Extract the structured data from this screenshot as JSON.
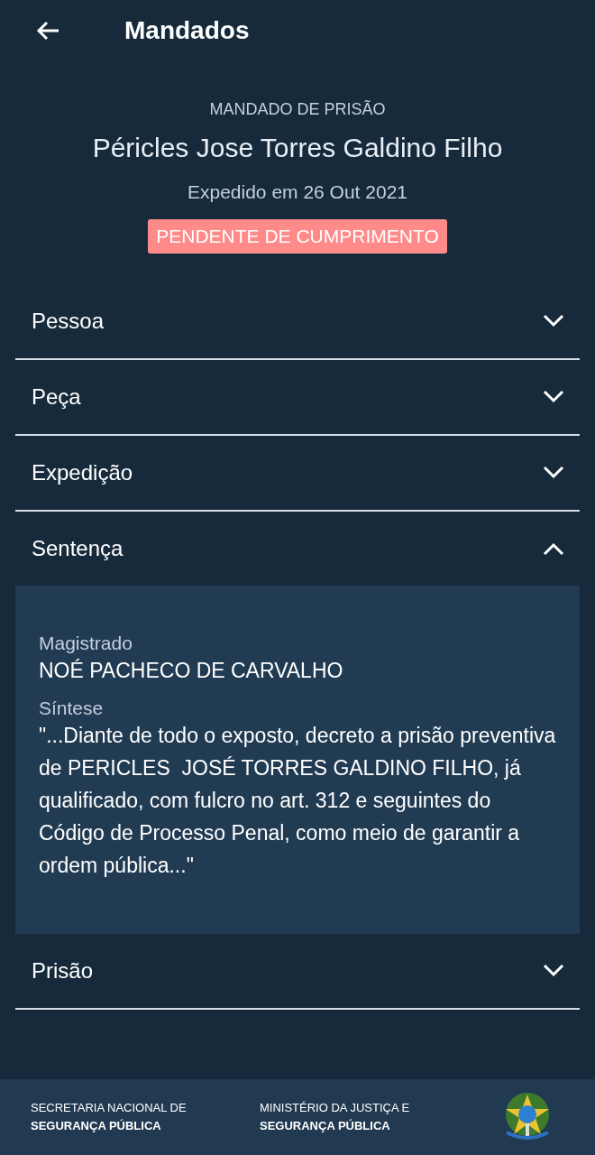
{
  "app_bar": {
    "title": "Mandados"
  },
  "header": {
    "type": "MANDADO DE PRISÃO",
    "name": "Péricles Jose Torres Galdino Filho",
    "issued": "Expedido em 26 Out 2021",
    "status": "PENDENTE DE CUMPRIMENTO"
  },
  "sections": [
    {
      "label": "Pessoa",
      "expanded": false
    },
    {
      "label": "Peça",
      "expanded": false
    },
    {
      "label": "Expedição",
      "expanded": false
    },
    {
      "label": "Sentença",
      "expanded": true,
      "fields": [
        {
          "label": "Magistrado",
          "value": "NOÉ PACHECO DE CARVALHO"
        },
        {
          "label": "Síntese",
          "value": "\"...Diante de todo o exposto, decreto a prisão preventiva de PERICLES  JOSÉ TORRES GALDINO FILHO, já qualificado, com fulcro no art. 312 e seguintes do Código de Processo Penal, como meio de garantir a ordem pública...\""
        }
      ]
    },
    {
      "label": "Prisão",
      "expanded": false
    }
  ],
  "footer": {
    "orgs": [
      {
        "line_1": "SECRETARIA NACIONAL DE",
        "line_2": "SEGURANÇA PÚBLICA"
      },
      {
        "line_1": "MINISTÉRIO DA JUSTIÇA E",
        "line_2": "SEGURANÇA PÚBLICA"
      }
    ]
  }
}
